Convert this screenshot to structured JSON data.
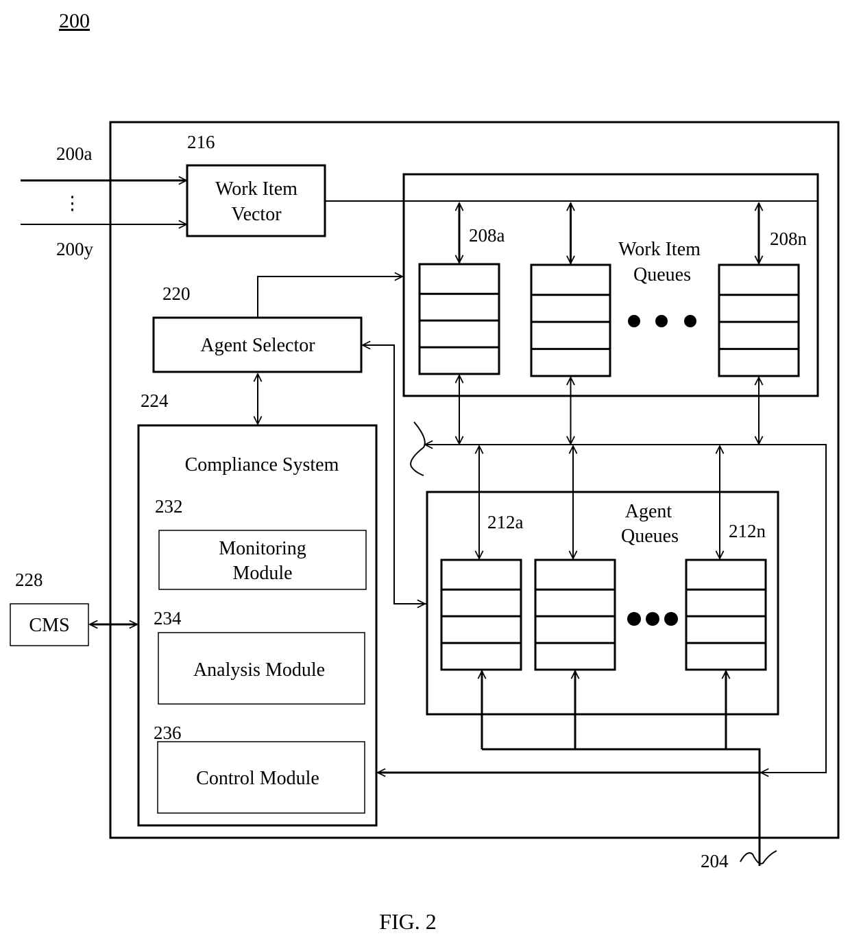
{
  "figure": {
    "number_label": "200",
    "caption": "FIG. 2"
  },
  "inputs": {
    "first_label": "200a",
    "last_label": "200y",
    "ellipsis": "⋮"
  },
  "work_item_vector": {
    "ref": "216",
    "line1": "Work Item",
    "line2": "Vector"
  },
  "work_item_queues": {
    "line1": "Work Item",
    "line2": "Queues",
    "first_ref": "208a",
    "last_ref": "208n",
    "queue_count_shown": 3,
    "slots_per_queue": 4
  },
  "agent_selector": {
    "ref": "220",
    "label": "Agent Selector"
  },
  "agent_queues": {
    "line1": "Agent",
    "line2": "Queues",
    "first_ref": "212a",
    "last_ref": "212n",
    "queue_count_shown": 3,
    "slots_per_queue": 4
  },
  "compliance_system": {
    "ref": "224",
    "label": "Compliance System",
    "modules": [
      {
        "ref": "232",
        "line1": "Monitoring",
        "line2": "Module"
      },
      {
        "ref": "234",
        "line1": "Analysis Module",
        "line2": ""
      },
      {
        "ref": "236",
        "line1": "Control Module",
        "line2": ""
      }
    ]
  },
  "cms": {
    "ref": "228",
    "label": "CMS"
  },
  "bus": {
    "ref": "204"
  }
}
